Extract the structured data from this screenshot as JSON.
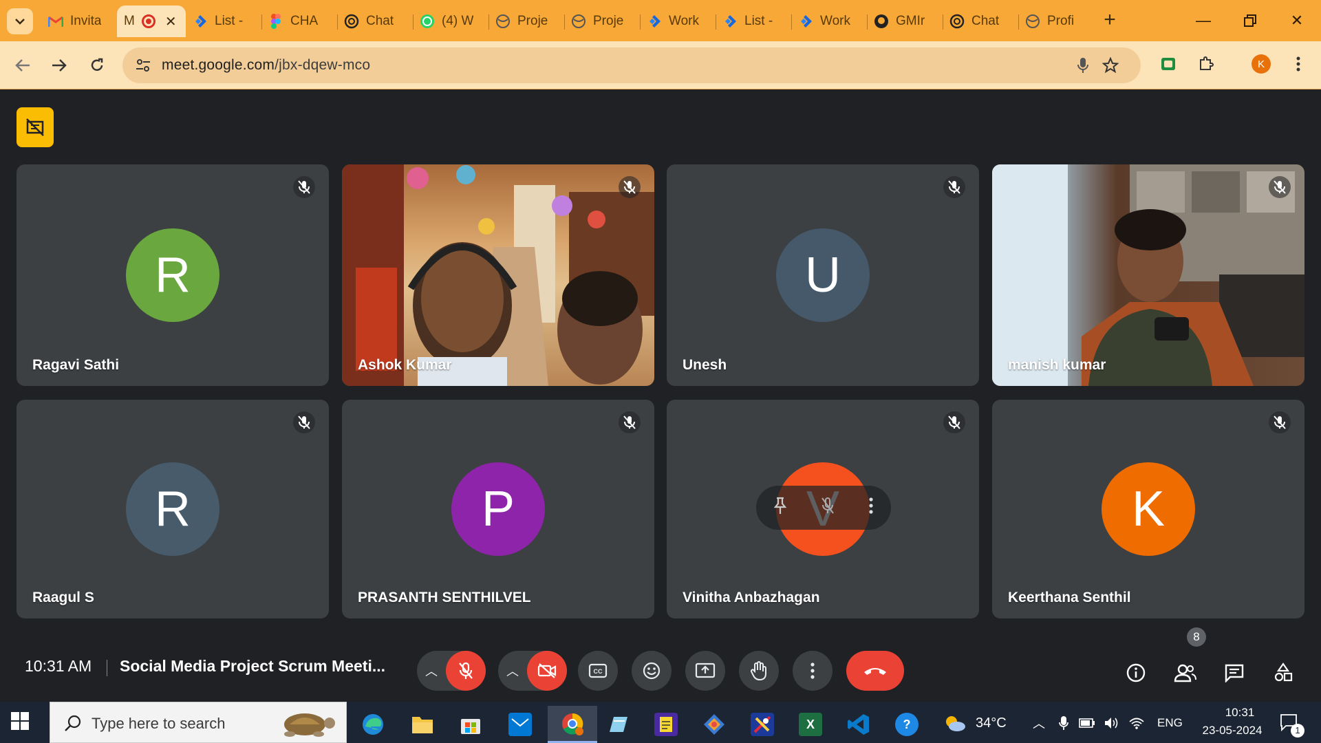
{
  "browser": {
    "tabs": [
      {
        "label": "Invita",
        "icon": "gmail-icon"
      },
      {
        "label": "M",
        "icon": "meet-icon",
        "active": true
      },
      {
        "label": "List -",
        "icon": "jira-icon"
      },
      {
        "label": "CHA",
        "icon": "figma-icon"
      },
      {
        "label": "Chat",
        "icon": "chatgpt-icon"
      },
      {
        "label": "(4) W",
        "icon": "whatsapp-icon"
      },
      {
        "label": "Proje",
        "icon": "globe-icon"
      },
      {
        "label": "Proje",
        "icon": "globe-icon"
      },
      {
        "label": "Work",
        "icon": "jira-icon"
      },
      {
        "label": "List -",
        "icon": "jira-icon"
      },
      {
        "label": "Work",
        "icon": "jira-icon"
      },
      {
        "label": "GMIr",
        "icon": "github-icon"
      },
      {
        "label": "Chat",
        "icon": "chatgpt-icon"
      },
      {
        "label": "Profi",
        "icon": "globe-icon"
      }
    ],
    "url_host": "meet.google.com",
    "url_path": "/jbx-dqew-mco",
    "profile_initial": "K"
  },
  "participants": [
    {
      "name": "Ragavi Sathi",
      "initial": "R",
      "color": "#6aa73f",
      "video": false
    },
    {
      "name": "Ashok Kumar",
      "initial": "",
      "color": "",
      "video": true
    },
    {
      "name": "Unesh",
      "initial": "U",
      "color": "#45596b",
      "video": false
    },
    {
      "name": "manish kumar",
      "initial": "",
      "color": "",
      "video": true
    },
    {
      "name": "Raagul S",
      "initial": "R",
      "color": "#475b6b",
      "video": false
    },
    {
      "name": "PRASANTH SENTHILVEL",
      "initial": "P",
      "color": "#8e24aa",
      "video": false
    },
    {
      "name": "Vinitha Anbazhagan",
      "initial": "V",
      "color": "#f4511e",
      "video": false
    },
    {
      "name": "Keerthana Senthil",
      "initial": "K",
      "color": "#ef6c00",
      "video": false
    }
  ],
  "meeting": {
    "time": "10:31 AM",
    "title": "Social Media Project Scrum Meeti...",
    "participant_count": "8"
  },
  "taskbar": {
    "search_placeholder": "Type here to search",
    "weather": "34°C",
    "language": "ENG",
    "time": "10:31",
    "date": "23-05-2024",
    "notification_count": "1"
  }
}
